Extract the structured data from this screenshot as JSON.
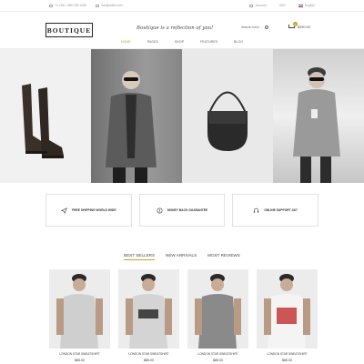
{
  "topbar": {
    "phone": "+1 245 1 385 295 1255",
    "email": "info@arkhi.com",
    "account": "Account",
    "currency": "USD",
    "language": "English"
  },
  "header": {
    "logo": "BOUTIQUE",
    "tagline": "Boutique is a reflection of you!",
    "search_placeholder": "Search here...",
    "cart_count": "0",
    "cart_total": "$290.00"
  },
  "nav": {
    "items": [
      "HOME",
      "PAGES",
      "SHOP",
      "FEATURES",
      "BLOG"
    ],
    "active": "HOME"
  },
  "features": [
    {
      "label": "FREE SHIPPING WORLD WIDE",
      "icon": "paper-plane-icon"
    },
    {
      "label": "MONEY BACK GUARANTEE",
      "icon": "money-back-icon"
    },
    {
      "label": "ONLINE SUPPORT 24/7",
      "icon": "headset-icon"
    }
  ],
  "tabs": {
    "items": [
      "BEST SELLERS",
      "NEW ARRIVALS",
      "MOST REVIEWS"
    ],
    "active": "BEST SELLERS"
  },
  "products": [
    {
      "name": "LONDON STAR SWEATSHIRT",
      "price": "$85.00",
      "shirt": "#cfcfcf",
      "print": "none"
    },
    {
      "name": "LONDON STAR SWEATSHIRT",
      "price": "$85.00",
      "shirt": "#d4d4d4",
      "print": "BOSTON"
    },
    {
      "name": "LONDON STAR SWEATSHIRT",
      "price": "$85.00",
      "shirt": "#8a8a8a",
      "print": "none"
    },
    {
      "name": "LONDON STAR SWEATSHIRT",
      "price": "$85.00",
      "shirt": "#f4f4f4",
      "print": "DTK"
    }
  ],
  "colors": {
    "accent": "#c9a227",
    "border": "#e2e2e2"
  }
}
